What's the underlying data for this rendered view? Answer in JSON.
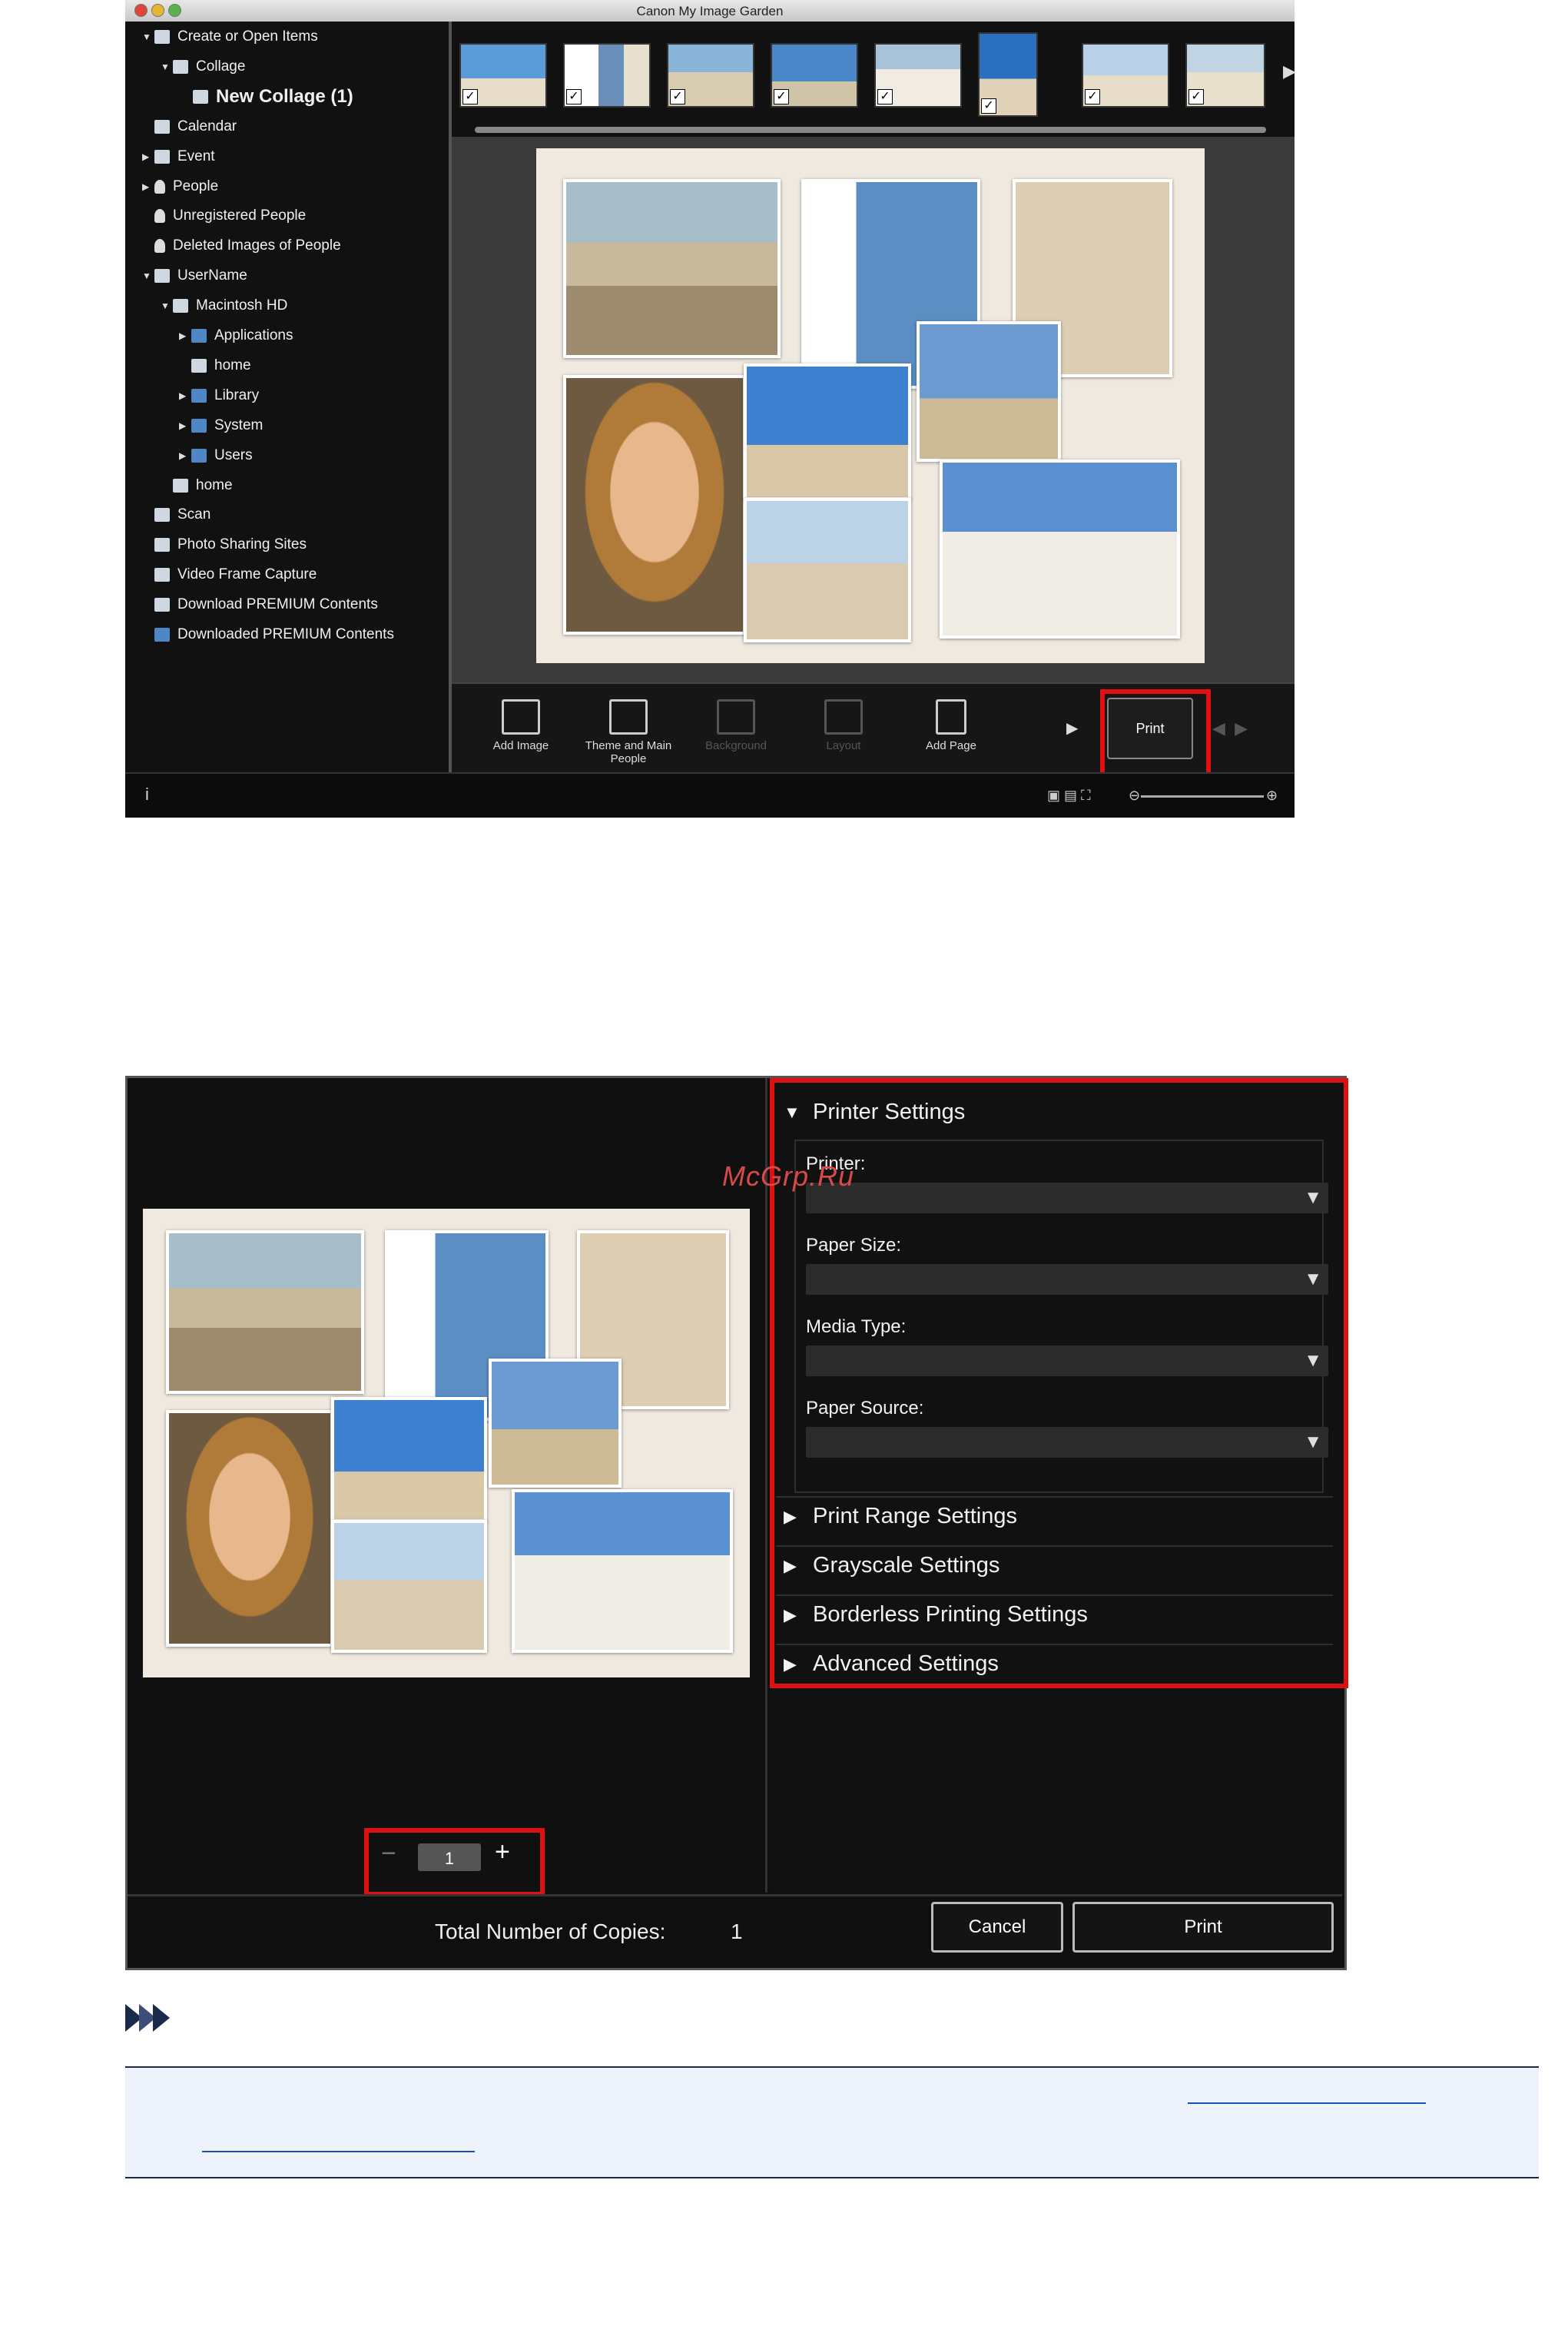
{
  "top_window": {
    "title": "Canon My Image Garden",
    "sidebar": {
      "items": [
        {
          "label": "Create or Open Items",
          "arrow": "▼"
        },
        {
          "label": "Collage",
          "arrow": "▼"
        },
        {
          "label": "New Collage (1)",
          "arrow": ""
        },
        {
          "label": "Calendar",
          "arrow": ""
        },
        {
          "label": "Event",
          "arrow": "▶"
        },
        {
          "label": "People",
          "arrow": "▶"
        },
        {
          "label": "Unregistered People",
          "arrow": ""
        },
        {
          "label": "Deleted Images of People",
          "arrow": ""
        },
        {
          "label": "UserName",
          "arrow": "▼"
        },
        {
          "label": "Macintosh HD",
          "arrow": "▼"
        },
        {
          "label": "Applications",
          "arrow": "▶"
        },
        {
          "label": "home",
          "arrow": ""
        },
        {
          "label": "Library",
          "arrow": "▶"
        },
        {
          "label": "System",
          "arrow": "▶"
        },
        {
          "label": "Users",
          "arrow": "▶"
        },
        {
          "label": "home",
          "arrow": ""
        },
        {
          "label": "Scan",
          "arrow": ""
        },
        {
          "label": "Photo Sharing Sites",
          "arrow": ""
        },
        {
          "label": "Video Frame Capture",
          "arrow": ""
        },
        {
          "label": "Download PREMIUM Contents",
          "arrow": ""
        },
        {
          "label": "Downloaded PREMIUM Contents",
          "arrow": ""
        }
      ]
    },
    "thumbnails": {
      "checkmark": "✓",
      "next_arrow": "▶"
    },
    "toolbar": {
      "add_image": "Add Image",
      "theme_main_people": "Theme and Main People",
      "background": "Background",
      "layout": "Layout",
      "add_page": "Add Page",
      "more": "▶",
      "print": "Print",
      "prev_page": "◀",
      "next_page": "▶"
    },
    "status": {
      "info_icon": "i",
      "zoom_out": "⊖",
      "zoom_in": "⊕"
    }
  },
  "print_dialog": {
    "stepper": {
      "minus": "−",
      "value": "1",
      "plus": "+"
    },
    "printer_settings": {
      "title": "Printer Settings",
      "expanded_icon": "▼",
      "collapsed_icon": "▶",
      "fields": [
        {
          "label": "Printer:"
        },
        {
          "label": "Paper Size:"
        },
        {
          "label": "Media Type:"
        },
        {
          "label": "Paper Source:"
        }
      ]
    },
    "sections": [
      "Print Range Settings",
      "Grayscale Settings",
      "Borderless Printing Settings",
      "Advanced Settings"
    ],
    "footer": {
      "total_label": "Total Number of Copies:",
      "total_value": "1",
      "cancel": "Cancel",
      "print": "Print"
    }
  },
  "watermark": "McGrp.Ru",
  "colors": {
    "highlight": "#e01010",
    "note_accent": "#1b2a4a",
    "link": "#1a4fc0"
  }
}
